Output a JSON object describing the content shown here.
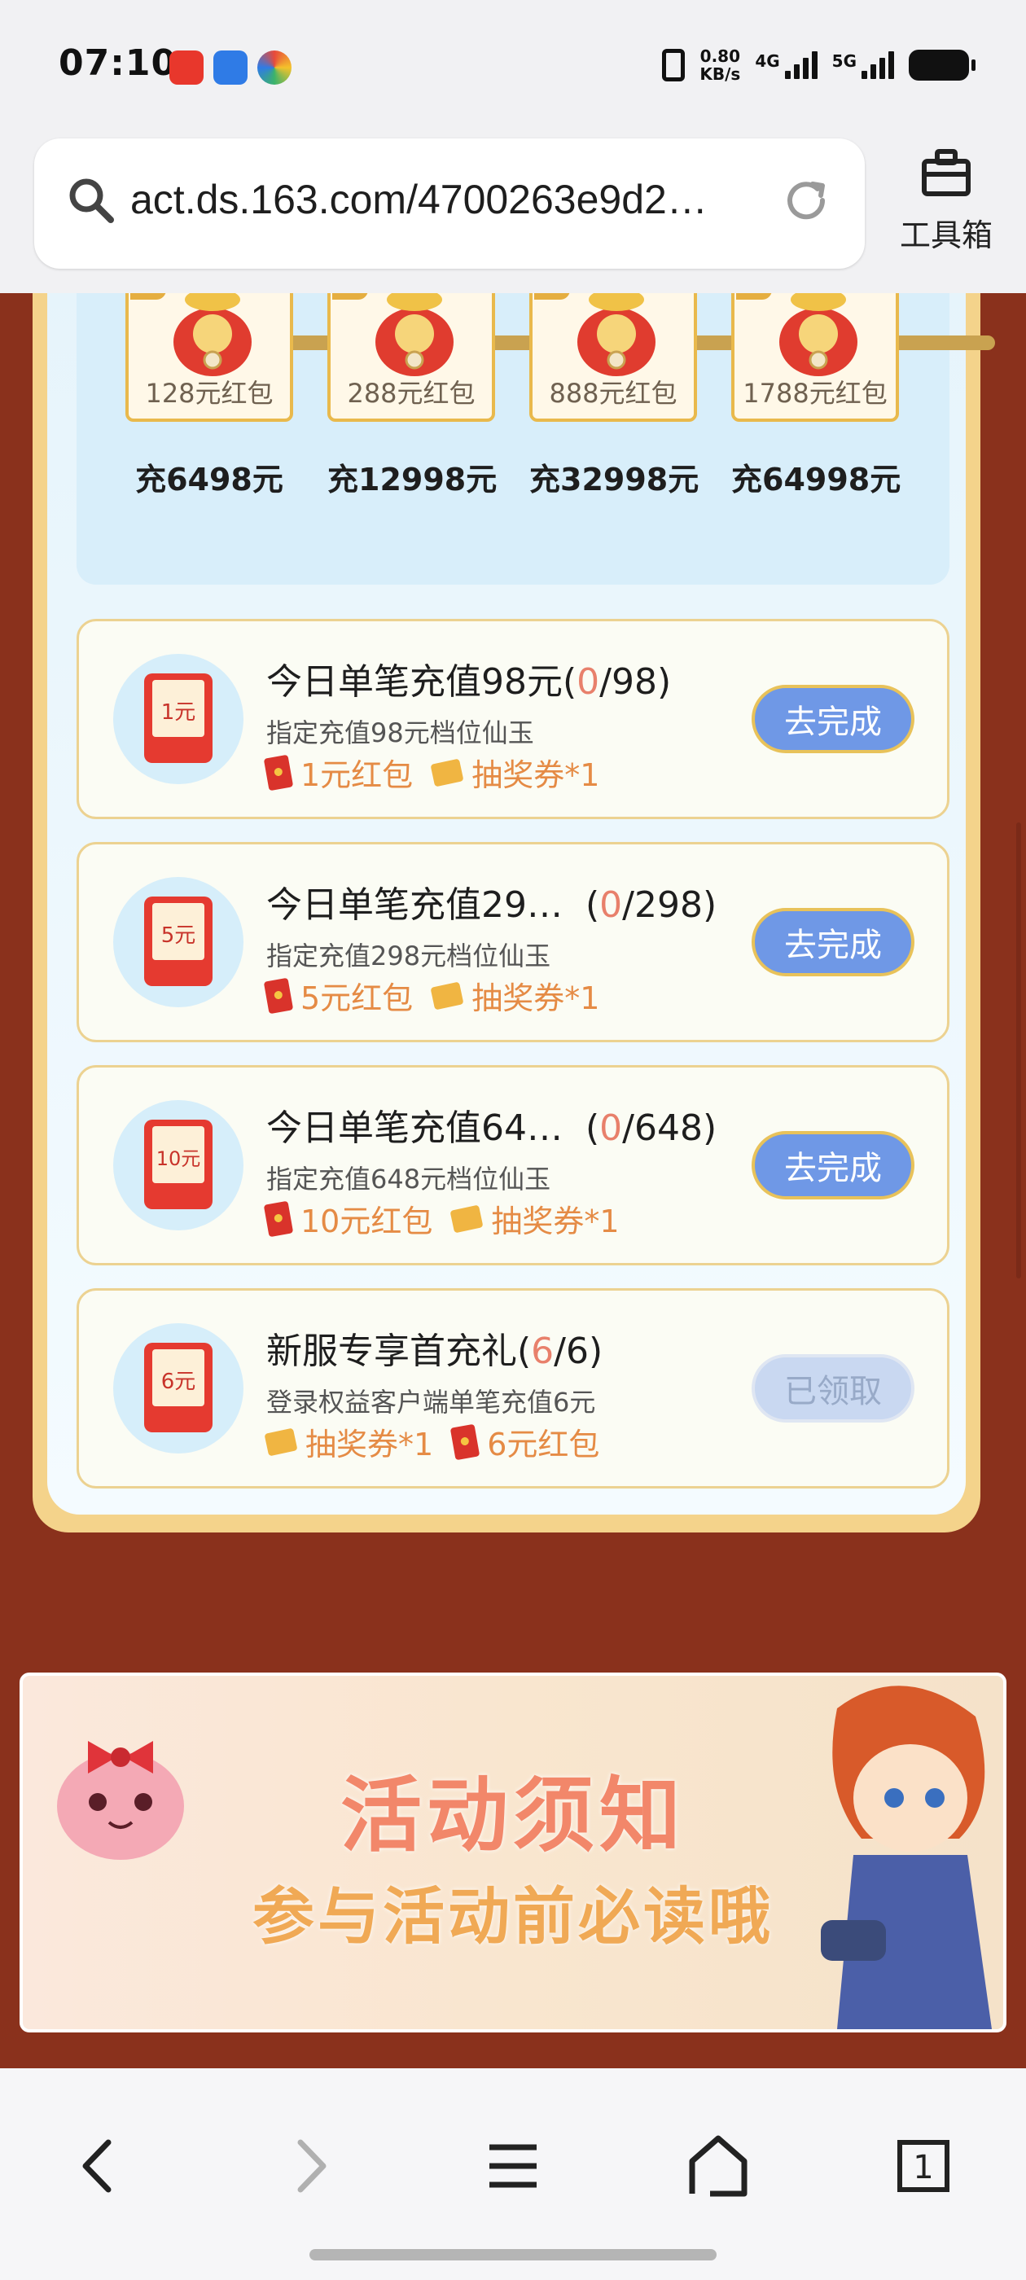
{
  "status_bar": {
    "time": "07:10",
    "speed_value": "0.80",
    "speed_unit": "KB/s",
    "net1": "4G",
    "net2": "5G",
    "app_icons": [
      "app-icon-red",
      "app-icon-blue",
      "app-icon-colorful"
    ]
  },
  "browser": {
    "url": "act.ds.163.com/4700263e9d2…",
    "toolbox_label": "工具箱"
  },
  "milestones": [
    {
      "reward": "128元红包",
      "condition": "充6498元"
    },
    {
      "reward": "288元红包",
      "condition": "充12998元"
    },
    {
      "reward": "888元红包",
      "condition": "充32998元"
    },
    {
      "reward": "1788元红包",
      "condition": "充64998元"
    }
  ],
  "tasks": [
    {
      "icon_label": "1元",
      "title": "今日单笔充值98元",
      "progress_open": "(",
      "progress_current": "0",
      "progress_total": "/98)",
      "desc": "指定充值98元档位仙玉",
      "reward1": "1元红包",
      "reward2": "抽奖券*1",
      "button": "去完成"
    },
    {
      "icon_label": "5元",
      "title": "今日单笔充值29…",
      "progress_open": "  (",
      "progress_current": "0",
      "progress_total": "/298)",
      "desc": "指定充值298元档位仙玉",
      "reward1": "5元红包",
      "reward2": "抽奖券*1",
      "button": "去完成"
    },
    {
      "icon_label": "10元",
      "title": "今日单笔充值64…",
      "progress_open": "  (",
      "progress_current": "0",
      "progress_total": "/648)",
      "desc": "指定充值648元档位仙玉",
      "reward1": "10元红包",
      "reward2": "抽奖券*1",
      "button": "去完成"
    },
    {
      "icon_label": "6元",
      "title": "新服专享首充礼",
      "progress_open": "(",
      "progress_current": "6",
      "progress_total": "/6)",
      "desc": "登录权益客户端单笔充值6元",
      "reward1": "抽奖券*1",
      "reward2": "6元红包",
      "button": "已领取"
    }
  ],
  "banner": {
    "title": "活动须知",
    "subtitle": "参与活动前必读哦"
  },
  "bottom_nav": {
    "tab_count": "1"
  },
  "colors": {
    "page_background": "#8a311c",
    "accent_button": "#6f98e6",
    "progress_highlight": "#e8806b",
    "reward_text": "#e58b45"
  }
}
